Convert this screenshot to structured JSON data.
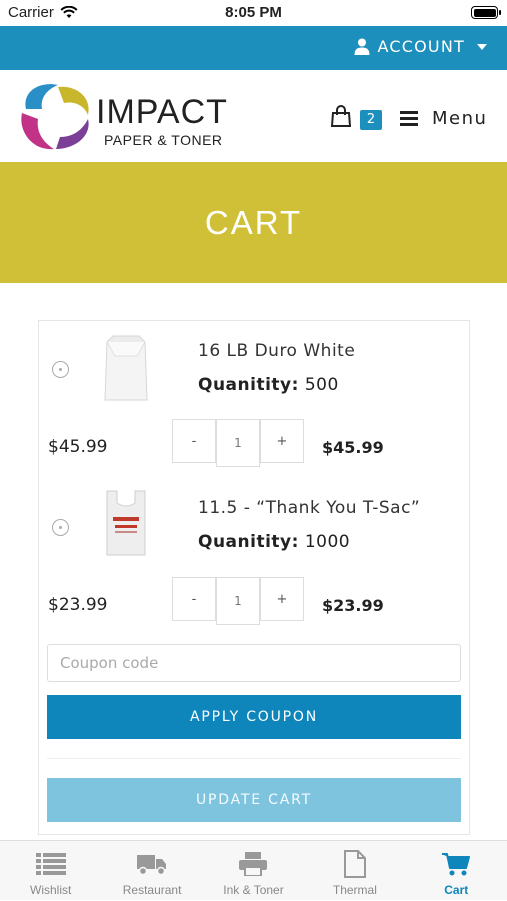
{
  "status_bar": {
    "carrier": "Carrier",
    "time": "8:05 PM"
  },
  "account": {
    "label": "ACCOUNT"
  },
  "header": {
    "logo_title": "IMPACT",
    "logo_subtitle": "PAPER & TONER",
    "cart_count": "2",
    "menu_label": "Menu"
  },
  "banner": {
    "title": "CART"
  },
  "cart": {
    "items": [
      {
        "name": "16 LB Duro White",
        "quantity_label": "Quanitity:",
        "quantity_value": "500",
        "price": "$45.99",
        "qty": "1",
        "total": "$45.99",
        "minus": "-",
        "plus": "+"
      },
      {
        "name": "11.5 - “Thank You T-Sac”",
        "quantity_label": "Quanitity:",
        "quantity_value": "1000",
        "price": "$23.99",
        "qty": "1",
        "total": "$23.99",
        "minus": "-",
        "plus": "+"
      }
    ],
    "coupon_placeholder": "Coupon code",
    "apply_label": "APPLY COUPON",
    "update_label": "UPDATE CART"
  },
  "tabbar": {
    "tabs": [
      {
        "label": "Wishlist",
        "icon": "list-icon",
        "active": false
      },
      {
        "label": "Restaurant",
        "icon": "truck-icon",
        "active": false
      },
      {
        "label": "Ink & Toner",
        "icon": "printer-icon",
        "active": false
      },
      {
        "label": "Thermal",
        "icon": "document-icon",
        "active": false
      },
      {
        "label": "Cart",
        "icon": "cart-icon",
        "active": true
      }
    ]
  },
  "colors": {
    "brand_blue": "#1d8fbc",
    "banner_yellow": "#cfc037",
    "button_blue": "#0e86bb",
    "button_light": "#7fc4de"
  }
}
